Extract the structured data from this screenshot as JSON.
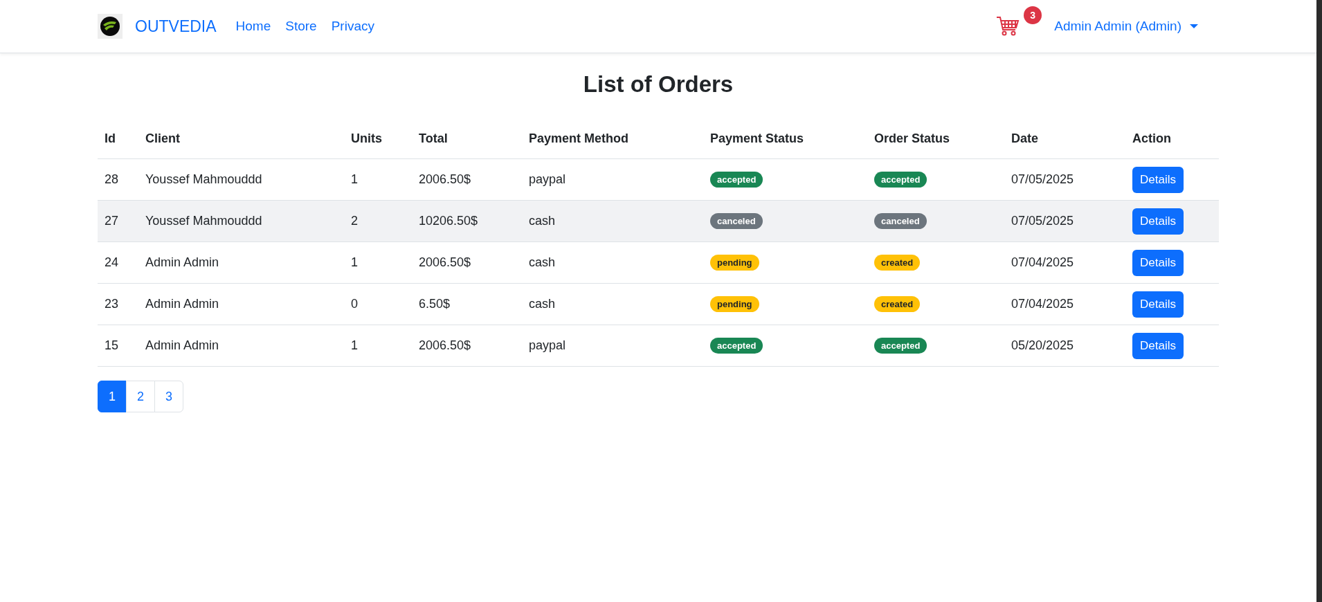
{
  "navbar": {
    "brand": "OUTVEDIA",
    "links": [
      "Home",
      "Store",
      "Privacy"
    ],
    "cart_count": "3",
    "user_menu": "Admin Admin (Admin)"
  },
  "title": "List of Orders",
  "table": {
    "columns": [
      "Id",
      "Client",
      "Units",
      "Total",
      "Payment Method",
      "Payment Status",
      "Order Status",
      "Date",
      "Action"
    ],
    "rows": [
      {
        "id": "28",
        "client": "Youssef Mahmouddd",
        "units": "1",
        "total": "2006.50$",
        "payment_method": "paypal",
        "payment_status": {
          "label": "accepted",
          "color": "#198754"
        },
        "order_status": {
          "label": "accepted",
          "color": "#198754"
        },
        "date": "07/05/2025",
        "action": "Details",
        "highlighted": false
      },
      {
        "id": "27",
        "client": "Youssef Mahmouddd",
        "units": "2",
        "total": "10206.50$",
        "payment_method": "cash",
        "payment_status": {
          "label": "canceled",
          "color": "#6c757d"
        },
        "order_status": {
          "label": "canceled",
          "color": "#6c757d"
        },
        "date": "07/05/2025",
        "action": "Details",
        "highlighted": true
      },
      {
        "id": "24",
        "client": "Admin Admin",
        "units": "1",
        "total": "2006.50$",
        "payment_method": "cash",
        "payment_status": {
          "label": "pending",
          "color": "#ffc107"
        },
        "order_status": {
          "label": "created",
          "color": "#ffc107"
        },
        "date": "07/04/2025",
        "action": "Details",
        "highlighted": false
      },
      {
        "id": "23",
        "client": "Admin Admin",
        "units": "0",
        "total": "6.50$",
        "payment_method": "cash",
        "payment_status": {
          "label": "pending",
          "color": "#ffc107"
        },
        "order_status": {
          "label": "created",
          "color": "#ffc107"
        },
        "date": "07/04/2025",
        "action": "Details",
        "highlighted": false
      },
      {
        "id": "15",
        "client": "Admin Admin",
        "units": "1",
        "total": "2006.50$",
        "payment_method": "paypal",
        "payment_status": {
          "label": "accepted",
          "color": "#198754"
        },
        "order_status": {
          "label": "accepted",
          "color": "#198754"
        },
        "date": "05/20/2025",
        "action": "Details",
        "highlighted": false
      }
    ]
  },
  "pagination": [
    {
      "label": "1",
      "selected": true
    },
    {
      "label": "2",
      "selected": false
    },
    {
      "label": "3",
      "selected": false
    }
  ]
}
